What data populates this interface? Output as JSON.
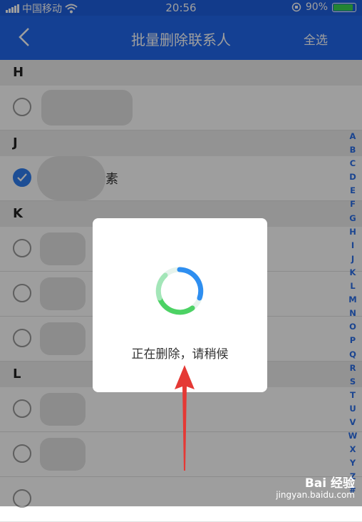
{
  "status_bar": {
    "carrier": "中国移动",
    "time": "20:56",
    "battery_percent": "90%",
    "battery_level": 0.9
  },
  "nav": {
    "title": "批量删除联系人",
    "select_all": "全选"
  },
  "sections": [
    {
      "letter": "H"
    },
    {
      "letter": "J"
    },
    {
      "letter": "K"
    },
    {
      "letter": "L"
    }
  ],
  "contacts": {
    "selected_name_fragment": "素"
  },
  "index_letters": [
    "A",
    "B",
    "C",
    "D",
    "E",
    "F",
    "G",
    "H",
    "I",
    "J",
    "K",
    "L",
    "M",
    "N",
    "O",
    "P",
    "Q",
    "R",
    "S",
    "T",
    "U",
    "V",
    "W",
    "X",
    "Y",
    "Z",
    "#"
  ],
  "dialog": {
    "message": "正在删除，请稍候"
  },
  "watermark": {
    "brand": "Bai 经验",
    "url": "jingyan.baidu.com"
  },
  "colors": {
    "accent": "#2168ee",
    "spinner_green": "#4cd264",
    "spinner_blue": "#2e8ef0",
    "arrow_red": "#e53935"
  }
}
